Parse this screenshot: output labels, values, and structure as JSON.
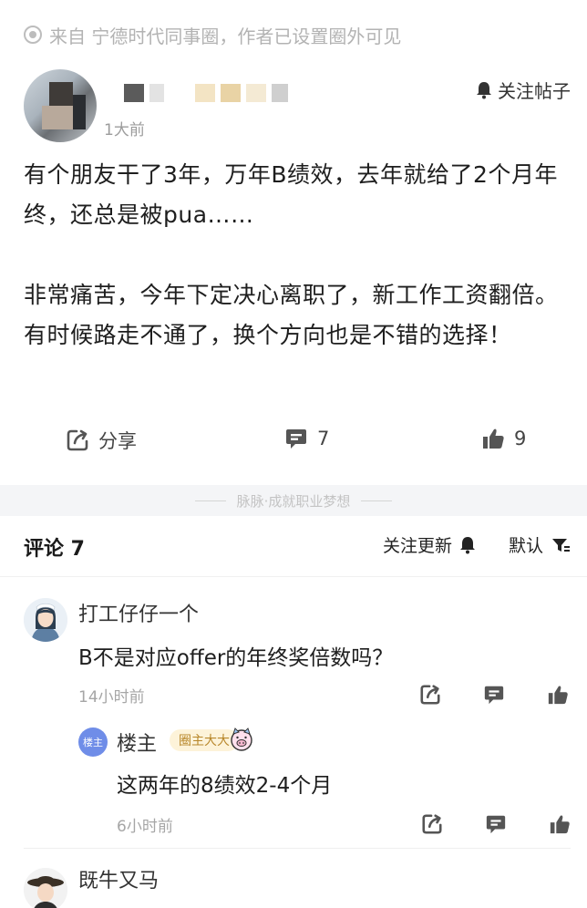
{
  "source": {
    "text": "来自 宁德时代同事圈，作者已设置圈外可见"
  },
  "author": {
    "time": "1大前",
    "follow_label": "关注帖子"
  },
  "post": {
    "paragraphs": [
      "有个朋友干了3年，万年B绩效，去年就给了2个月年终，还总是被pua……",
      "非常痛苦，今年下定决心离职了，新工作工资翻倍。有时候路走不通了，换个方向也是不错的选择！"
    ]
  },
  "actions": {
    "share_label": "分享",
    "comment_count": "7",
    "like_count": "9"
  },
  "divider": {
    "text": "脉脉·成就职业梦想"
  },
  "comments_header": {
    "title": "评论 7",
    "follow_update_label": "关注更新",
    "sort_label": "默认"
  },
  "comments": [
    {
      "name": "打工仔仔一个",
      "text": "B不是对应offer的年终奖倍数吗？",
      "time": "14小时前"
    },
    {
      "name": "既牛又马",
      "text": "",
      "time": ""
    }
  ],
  "reply": {
    "avatar_label": "楼主",
    "name": "楼主",
    "badge": "圈主大大",
    "text": "这两年的8绩效2-4个月",
    "time": "6小时前"
  },
  "icons": {
    "source": "eye-dot-icon",
    "follow": "bell-icon",
    "share": "share-icon",
    "comment": "comment-icon",
    "like": "thumbs-up-icon",
    "sort": "filter-icon"
  },
  "colors": {
    "accent": "#6f8de8",
    "badge_bg": "#fdf3d9",
    "badge_text": "#b8872a",
    "muted": "#a6a6a6"
  }
}
